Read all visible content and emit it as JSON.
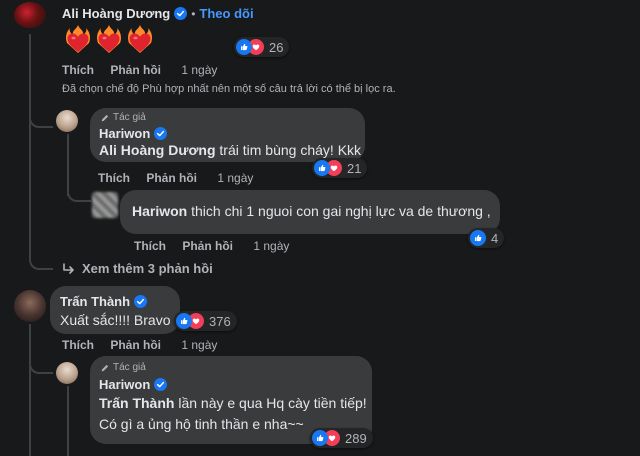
{
  "comment1": {
    "author": "Ali Hoàng Dương",
    "follow_label": "Theo dõi",
    "hearts": [
      "fire-heart",
      "fire-heart",
      "fire-heart"
    ],
    "reaction_count": "26",
    "like_label": "Thích",
    "reply_label": "Phản hồi",
    "time": "1 ngày",
    "filter_notice": "Đã chọn chế độ Phù hợp nhất nên một số câu trả lời có thể bị lọc ra."
  },
  "reply1": {
    "author_tag": "Tác giả",
    "author": "Hariwon",
    "mention": "Ali Hoàng Dương",
    "text": " trái tim bùng cháy! Kkk",
    "reaction_count": "21",
    "like_label": "Thích",
    "reply_label": "Phản hồi",
    "time": "1 ngày"
  },
  "reply2": {
    "mention": "Hariwon",
    "text": " thich chi 1 nguoi con gai nghị lực va de thương ,",
    "reaction_count": "4",
    "like_label": "Thích",
    "reply_label": "Phản hồi",
    "time": "1 ngày"
  },
  "more_replies": {
    "label": "Xem thêm 3 phản hồi"
  },
  "comment2": {
    "author": "Trấn Thành",
    "text": "Xuất sắc!!!! Bravo",
    "reaction_count": "376",
    "like_label": "Thích",
    "reply_label": "Phản hồi",
    "time": "1 ngày"
  },
  "reply3": {
    "author_tag": "Tác giả",
    "author": "Hariwon",
    "mention": "Trấn Thành",
    "line1": " lần này e qua Hq cày tiền tiếp!",
    "line2": "Có gì a ủng hộ tinh thần e nha~~",
    "reaction_count": "289"
  },
  "colors": {
    "background": "#18191a",
    "bubble": "#3a3b3c",
    "link_blue": "#4599ff",
    "like_blue": "#1877f2",
    "love_red": "#f33e58"
  }
}
